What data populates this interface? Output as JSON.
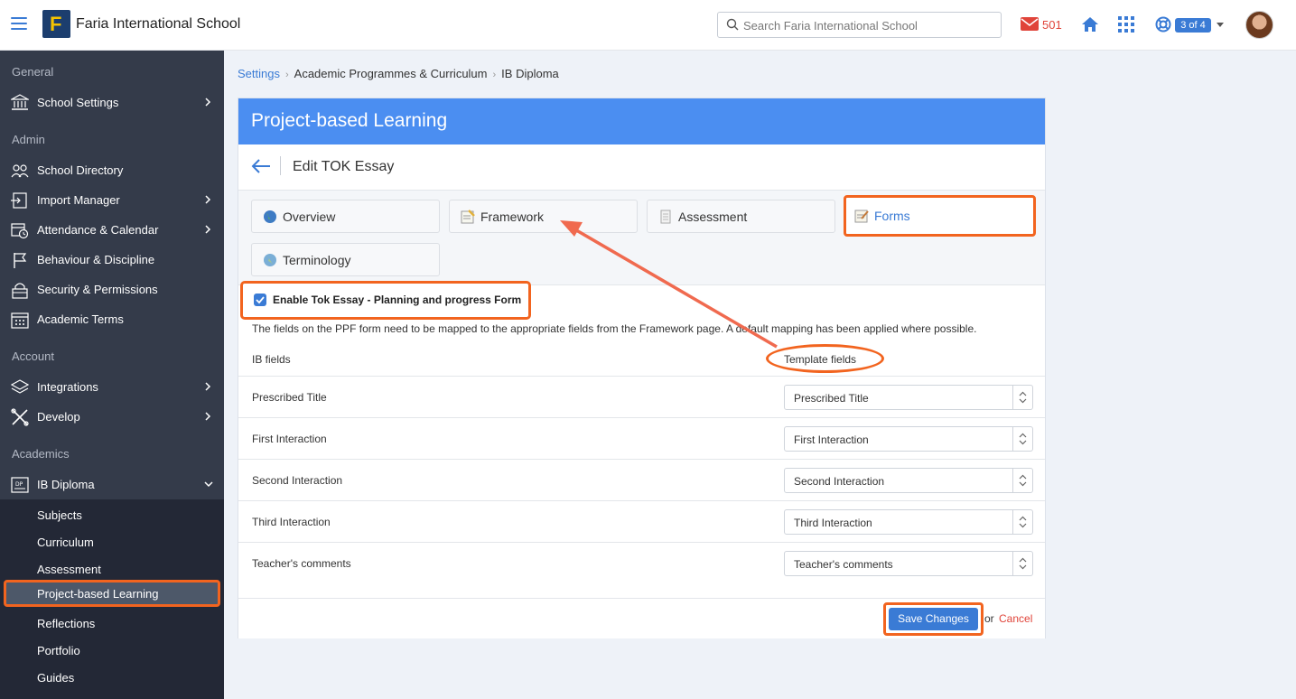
{
  "header": {
    "school_name": "Faria International School",
    "search_placeholder": "Search Faria International School",
    "mail_count": "501",
    "pager": "3 of 4"
  },
  "sidebar": {
    "sections": {
      "general": "General",
      "admin": "Admin",
      "account": "Account",
      "academics": "Academics"
    },
    "items": {
      "school_settings": "School Settings",
      "school_directory": "School Directory",
      "import_manager": "Import Manager",
      "attendance": "Attendance & Calendar",
      "behaviour": "Behaviour & Discipline",
      "security": "Security & Permissions",
      "academic_terms": "Academic Terms",
      "integrations": "Integrations",
      "develop": "Develop",
      "ib_diploma": "IB Diploma"
    },
    "sub_items": [
      "Subjects",
      "Curriculum",
      "Assessment",
      "Project-based Learning",
      "Reflections",
      "Portfolio",
      "Guides"
    ],
    "active_sub": "Project-based Learning"
  },
  "breadcrumb": {
    "settings": "Settings",
    "curriculum": "Academic Programmes & Curriculum",
    "current": "IB Diploma"
  },
  "page": {
    "title": "Project-based Learning",
    "edit_title": "Edit TOK Essay",
    "tabs": [
      "Overview",
      "Framework",
      "Assessment",
      "Forms",
      "Terminology"
    ],
    "active_tab": "Forms",
    "enable_label": "Enable Tok Essay - Planning and progress Form",
    "enable_checked": true,
    "help_text": "The fields on the PPF form need to be mapped to the appropriate fields from the Framework page. A default mapping has been applied where possible.",
    "col_ib": "IB fields",
    "col_template": "Template fields",
    "rows": [
      {
        "ib": "Prescribed Title",
        "template": "Prescribed Title"
      },
      {
        "ib": "First Interaction",
        "template": "First Interaction"
      },
      {
        "ib": "Second Interaction",
        "template": "Second Interaction"
      },
      {
        "ib": "Third Interaction",
        "template": "Third Interaction"
      },
      {
        "ib": "Teacher's comments",
        "template": "Teacher's comments"
      }
    ],
    "save_label": "Save Changes",
    "or_text": "or",
    "cancel_label": "Cancel"
  },
  "colors": {
    "accent": "#3a7bd5",
    "header_blue": "#4b8ef1",
    "highlight": "#f2641f",
    "sidebar_bg": "#343b4a",
    "danger": "#e0443a"
  }
}
